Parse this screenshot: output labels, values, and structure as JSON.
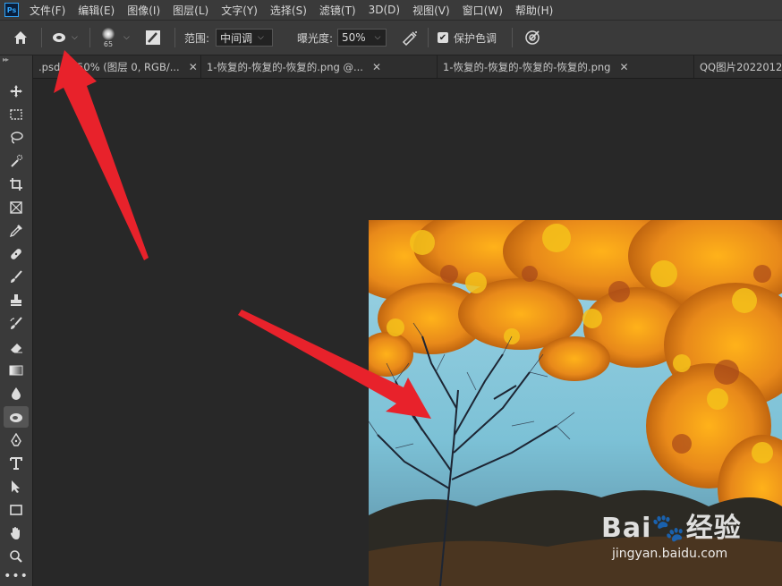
{
  "app": {
    "logo": "Ps"
  },
  "menu": [
    "文件(F)",
    "编辑(E)",
    "图像(I)",
    "图层(L)",
    "文字(Y)",
    "选择(S)",
    "滤镜(T)",
    "3D(D)",
    "视图(V)",
    "窗口(W)",
    "帮助(H)"
  ],
  "options": {
    "brush_size": "65",
    "range_label": "范围:",
    "range_value": "中间调",
    "exposure_label": "曝光度:",
    "exposure_value": "50%",
    "protect_tones_label": "保护色调",
    "protect_tones_checked": true
  },
  "tabs": [
    {
      "label": ".psd @ 50% (图层 0, RGB/..."
    },
    {
      "label": "1-恢复的-恢复的-恢复的.png @..."
    },
    {
      "label": "1-恢复的-恢复的-恢复的-恢复的.png"
    },
    {
      "label": "QQ图片2022012"
    }
  ],
  "watermark": {
    "logo": "Bai🐾经验",
    "url": "jingyan.baidu.com"
  },
  "colors": {
    "annotation_arrow": "#e8222b",
    "ui_bg": "#3a3a3a",
    "canvas_bg": "#282828"
  },
  "toolbar_icons": [
    "move-icon",
    "marquee-icon",
    "lasso-icon",
    "quick-select-icon",
    "crop-icon",
    "frame-icon",
    "eyedropper-icon",
    "healing-icon",
    "brush-icon",
    "stamp-icon",
    "history-brush-icon",
    "eraser-icon",
    "gradient-icon",
    "blur-icon",
    "sponge-icon",
    "pen-icon",
    "type-icon",
    "path-select-icon",
    "rectangle-icon",
    "hand-icon",
    "zoom-icon",
    "more-icon"
  ]
}
